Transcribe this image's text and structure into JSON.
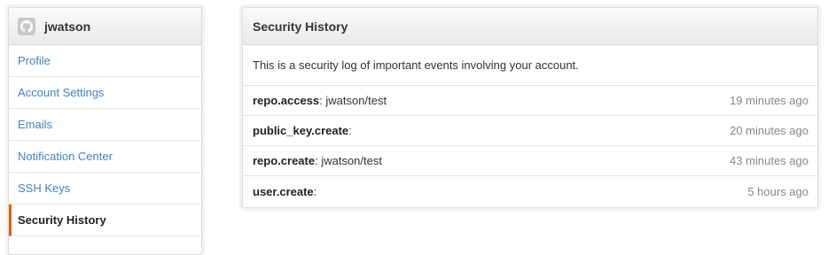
{
  "user": {
    "username": "jwatson"
  },
  "sidebar": {
    "items": [
      {
        "label": "Profile"
      },
      {
        "label": "Account Settings"
      },
      {
        "label": "Emails"
      },
      {
        "label": "Notification Center"
      },
      {
        "label": "SSH Keys"
      },
      {
        "label": "Security History"
      }
    ],
    "selected": "Security History"
  },
  "panel": {
    "title": "Security History",
    "description": "This is a security log of important events involving your account.",
    "events": [
      {
        "action": "repo.access",
        "separator": ":",
        "target": " jwatson/test",
        "time": "19 minutes ago"
      },
      {
        "action": "public_key.create",
        "separator": ":",
        "target": "",
        "time": "20 minutes ago"
      },
      {
        "action": "repo.create",
        "separator": ":",
        "target": " jwatson/test",
        "time": "43 minutes ago"
      },
      {
        "action": "user.create",
        "separator": ":",
        "target": "",
        "time": "5 hours ago"
      }
    ]
  },
  "colors": {
    "link": "#4183c4",
    "selected_accent": "#d26911",
    "muted": "#888888"
  }
}
